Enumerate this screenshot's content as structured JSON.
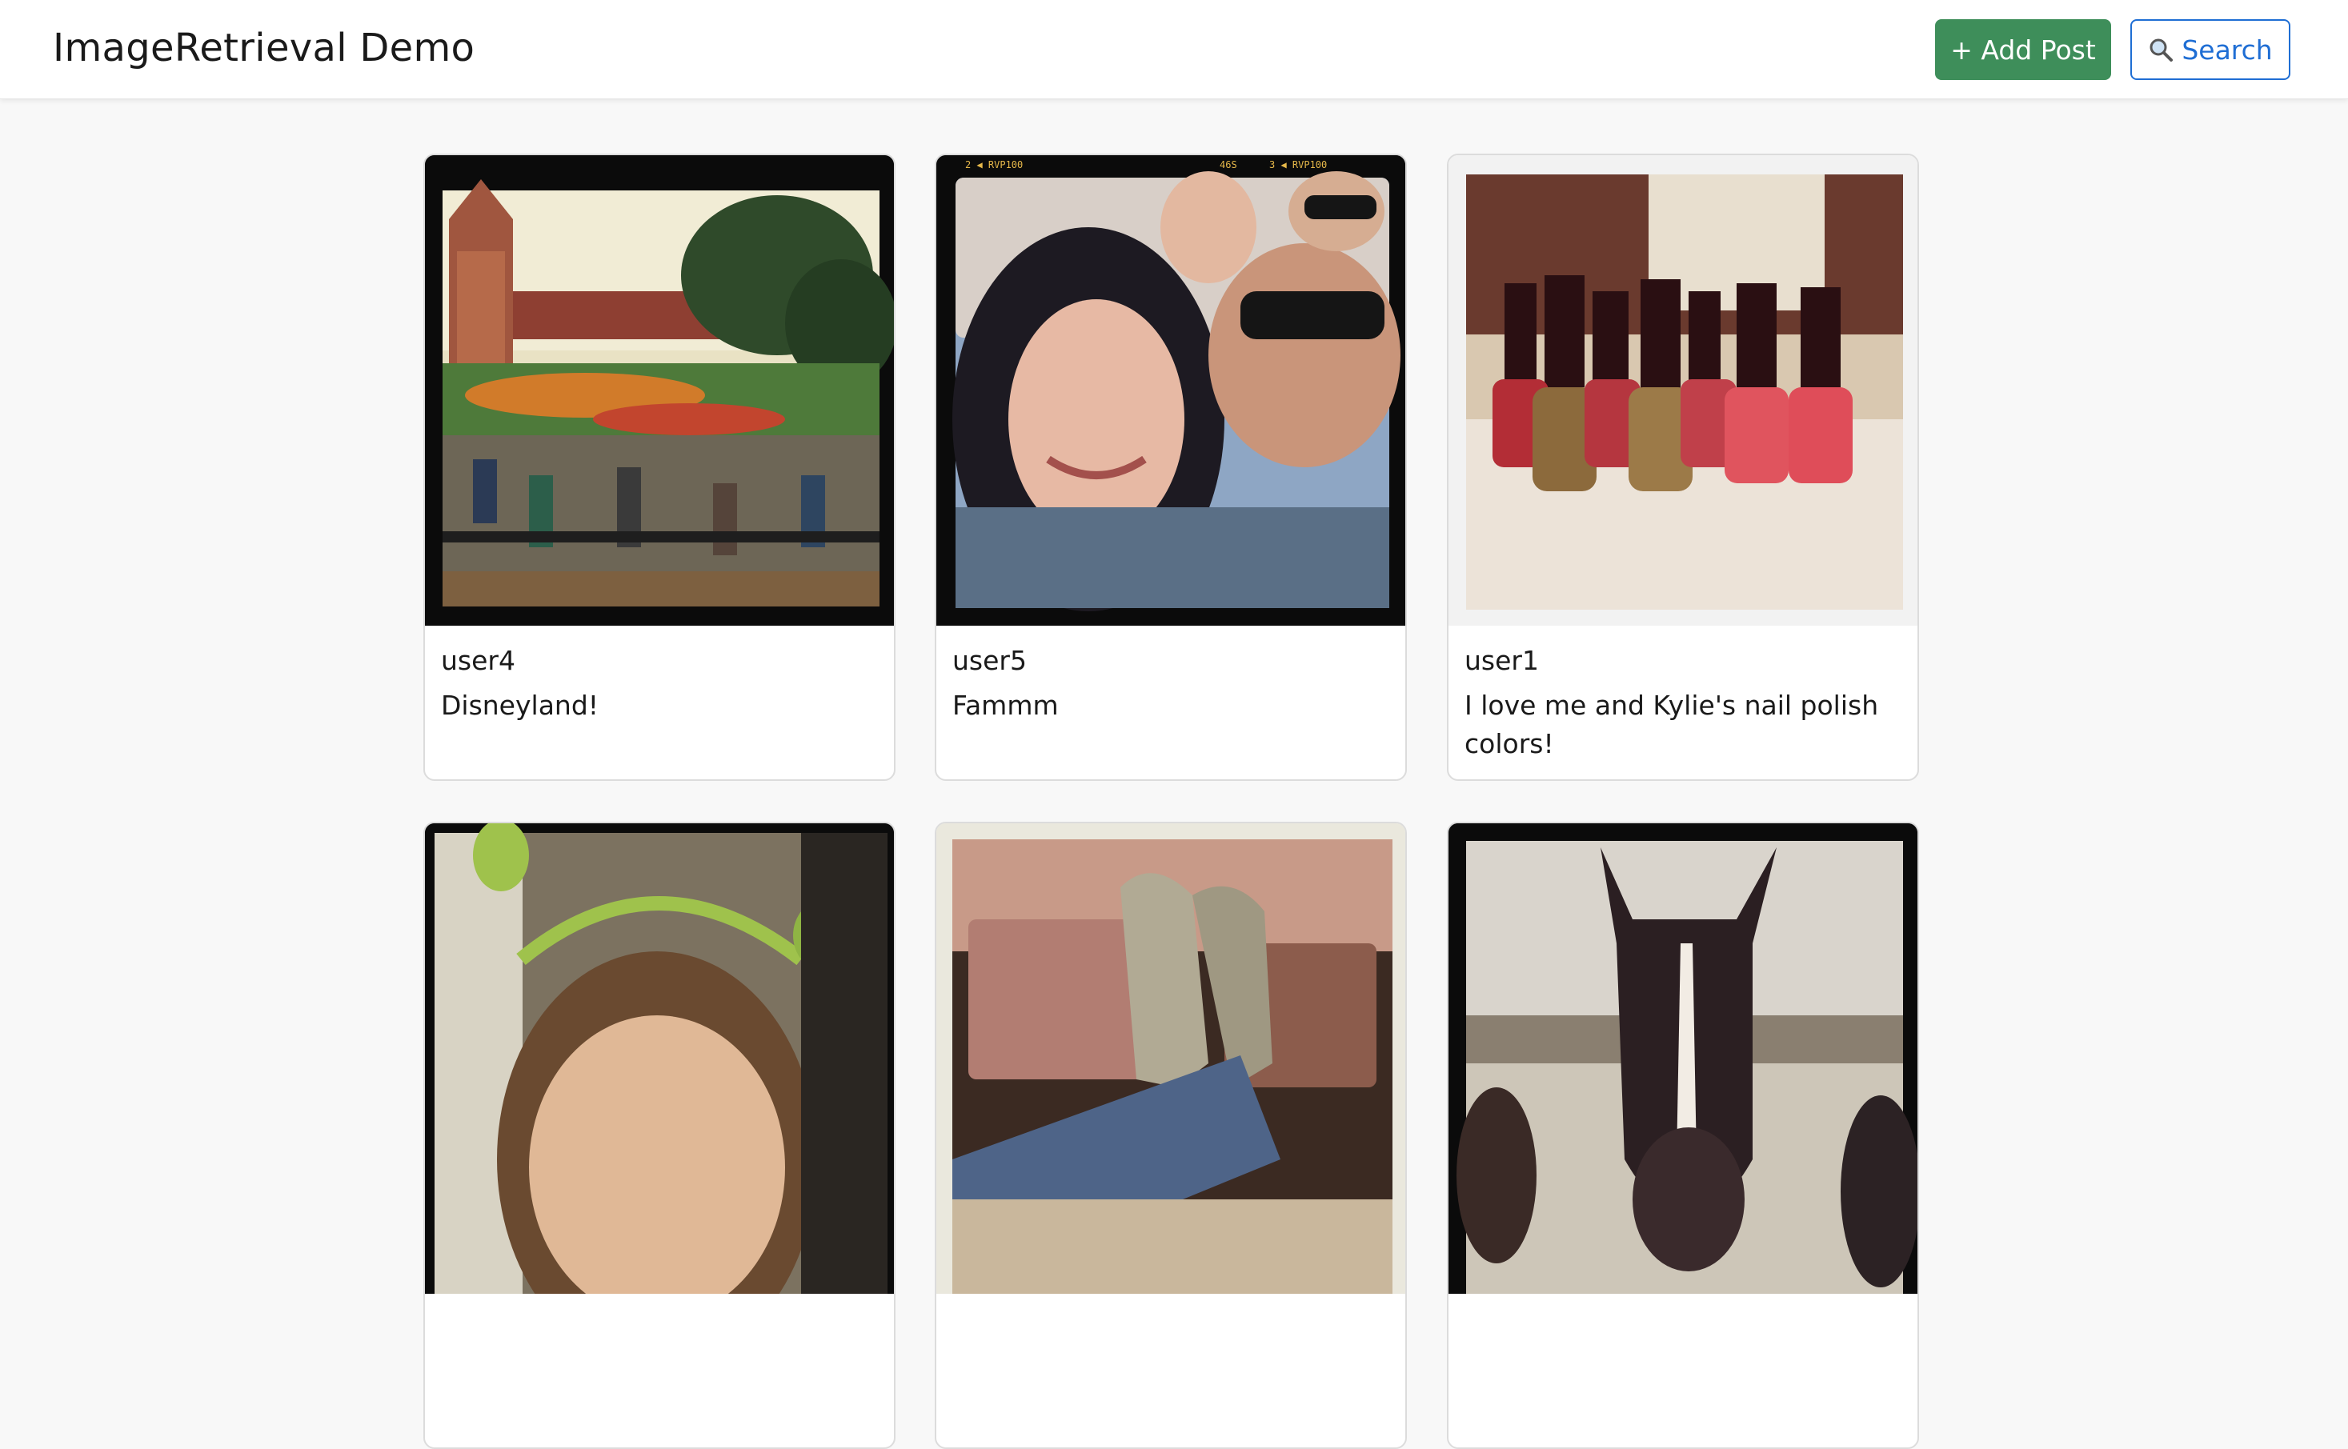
{
  "header": {
    "title": "ImageRetrieval Demo",
    "add_post_label": "+ Add Post",
    "search_label": "Search"
  },
  "colors": {
    "add_button": "#3e8e5a",
    "search_button": "#1f6ed4"
  },
  "posts": [
    {
      "username": "user4",
      "caption": "Disneyland!",
      "image": "disneyland-station-photo"
    },
    {
      "username": "user5",
      "caption": "Fammm",
      "image": "group-selfie-photo"
    },
    {
      "username": "user1",
      "caption": "I love me and Kylie's nail polish colors!",
      "image": "nail-polish-bottles-photo"
    },
    {
      "username": "",
      "caption": "",
      "image": "child-with-ears-headband-photo"
    },
    {
      "username": "",
      "caption": "",
      "image": "cowboy-boots-photo"
    },
    {
      "username": "",
      "caption": "",
      "image": "horse-close-up-photo"
    }
  ]
}
